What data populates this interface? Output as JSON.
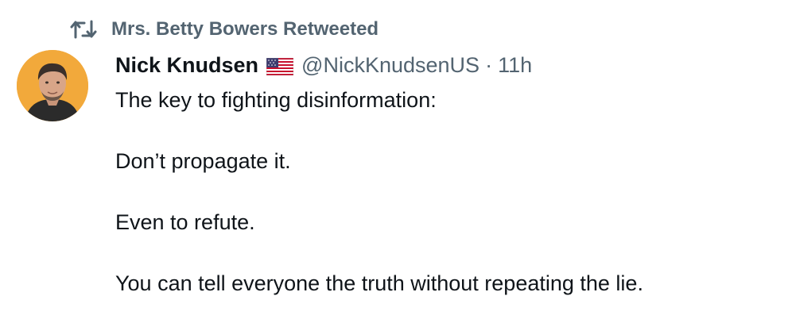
{
  "retweet": {
    "icon": "retweet-icon",
    "label": "Mrs. Betty Bowers Retweeted"
  },
  "author": {
    "display_name": "Nick Knudsen",
    "flag_icon": "us-flag-icon",
    "handle": "@NickKnudsenUS",
    "separator": "·",
    "timestamp": "11h"
  },
  "tweet": {
    "paragraphs": [
      "The key to fighting disinformation:",
      "Don’t propagate it.",
      "Even to refute.",
      "You can tell everyone the truth without repeating the lie."
    ]
  },
  "colors": {
    "text_primary": "#0f1419",
    "text_secondary": "#536471",
    "avatar_background": "#f2a93b"
  }
}
